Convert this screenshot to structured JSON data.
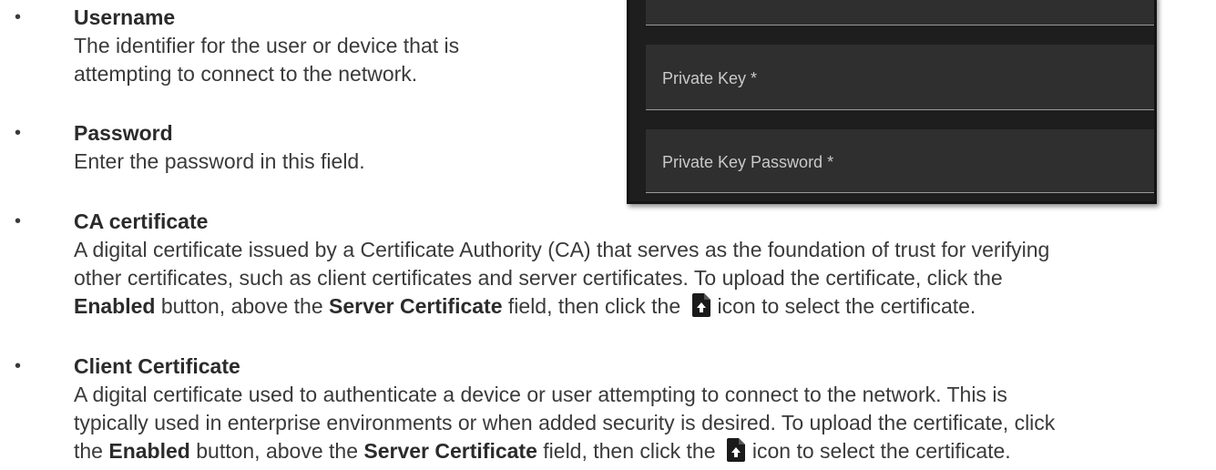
{
  "items": [
    {
      "title": "Username",
      "lines": [
        "The identifier for the user or device that is",
        "attempting to connect to the network."
      ]
    },
    {
      "title": "Password",
      "lines": [
        "Enter the password in this field."
      ]
    },
    {
      "title": "CA certificate",
      "lines": [
        "A digital certificate issued by a Certificate Authority (CA) that serves as the foundation of trust for verifying",
        "other certificates, such as client certificates and server certificates. To upload the certificate, click the"
      ],
      "last_line": {
        "enabled": "Enabled",
        "t1": " button, above the ",
        "server_cert": "Server Certificate",
        "t2": " field, then click the",
        "t3": "icon to select the certificate."
      }
    },
    {
      "title": "Client Certificate",
      "lines": [
        "A digital certificate used to authenticate a device or user attempting to connect to the network. This is",
        "typically used in enterprise environments or when added security is desired. To upload the certificate, click"
      ],
      "last_line": {
        "t0": "the ",
        "enabled": "Enabled",
        "t1": " button, above the ",
        "server_cert": "Server Certificate",
        "t2": " field, then click the",
        "t3": "icon to select the certificate."
      }
    }
  ],
  "panel": {
    "fields": [
      {
        "label": ""
      },
      {
        "label": "Private Key *"
      },
      {
        "label": "Private Key Password *"
      }
    ]
  },
  "icons": {
    "bullet": "bullet-dot",
    "inline_icon": "file-upload-icon"
  },
  "colors": {
    "text": "#3a3a3a",
    "panel_bg": "#1e1e1e",
    "field_bg": "#2f2f2f",
    "field_label": "#c9c9c9"
  }
}
